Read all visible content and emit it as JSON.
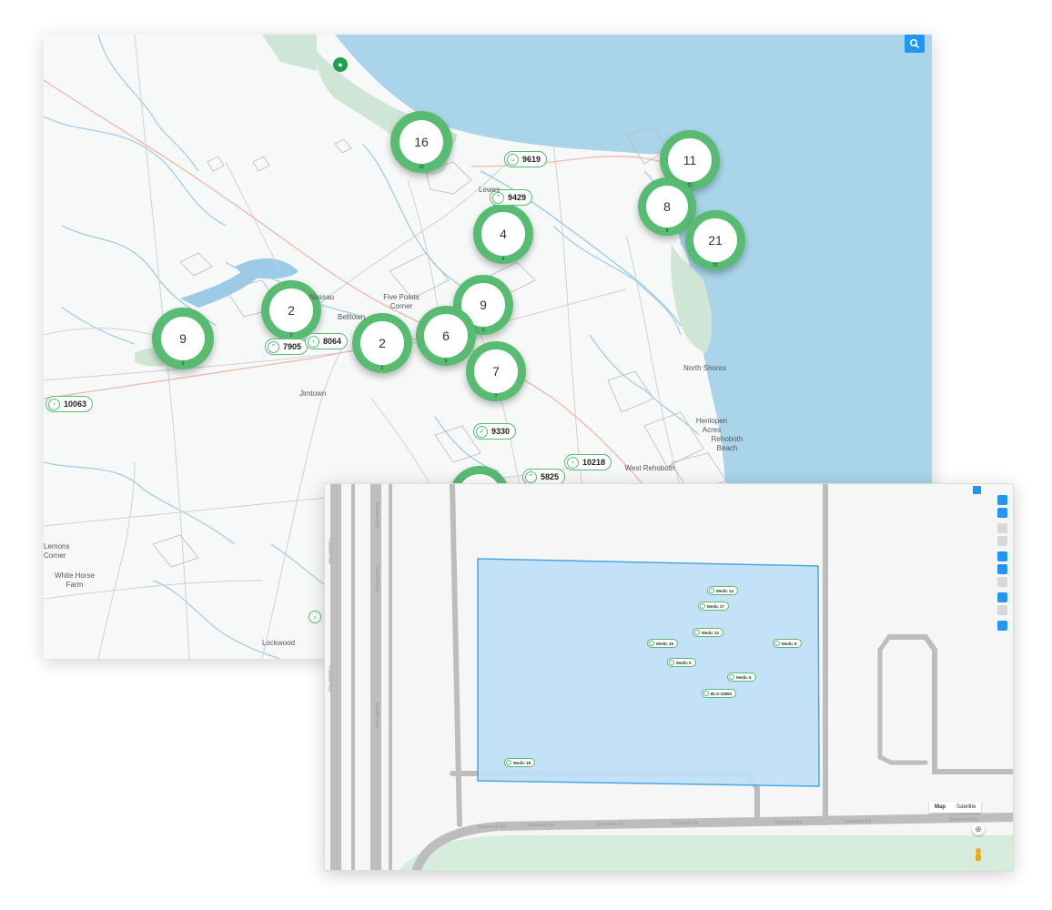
{
  "colors": {
    "cluster": "#58bb72",
    "water": "#a9d4ea",
    "park": "#cfe6d6",
    "selection": "#bfe0f7",
    "selection_border": "#4aa7e0",
    "accent": "#2196f3"
  },
  "map1": {
    "search_icon": "search-icon",
    "clusters": [
      {
        "count": "16",
        "sub": "16"
      },
      {
        "count": "11",
        "sub": "11"
      },
      {
        "count": "8",
        "sub": "8"
      },
      {
        "count": "21",
        "sub": "21"
      },
      {
        "count": "4",
        "sub": "4"
      },
      {
        "count": "9",
        "sub": "9"
      },
      {
        "count": "2",
        "sub": "2"
      },
      {
        "count": "9",
        "sub": "9"
      },
      {
        "count": "6",
        "sub": "6"
      },
      {
        "count": "2",
        "sub": "2"
      },
      {
        "count": "7",
        "sub": "7"
      }
    ],
    "pills": [
      "9619",
      "9429",
      "7905",
      "8064",
      "10063",
      "9330",
      "10218",
      "5825"
    ],
    "places": [
      "Lewes",
      "Nassau",
      "Belltown",
      "Five Points Corner",
      "Jimtown",
      "North Shores",
      "Henlopen Acres",
      "Rehoboth Beach",
      "West Rehoboth",
      "Lockwood",
      "White Horse Farm",
      "Lemons Corner"
    ]
  },
  "map2": {
    "devices": [
      "Medic 14",
      "Medic 27",
      "Medic 22",
      "Medic 26",
      "Medic 9",
      "Medic 8",
      "Medic 6",
      "BLS-10865",
      "Medic 18"
    ],
    "map_type": {
      "map": "Map",
      "satellite": "Satellite"
    },
    "road_labels": [
      "Coastal Hwy",
      "Coastal Hwy",
      "Coastal Hwy",
      "Coastal Hwy",
      "Coastal Hwy",
      "Savannah Rd",
      "Savannah Rd",
      "Savannah Rd",
      "Savannah Rd",
      "Savannah Rd",
      "Savannah Rd",
      "Savannah Rd"
    ]
  }
}
